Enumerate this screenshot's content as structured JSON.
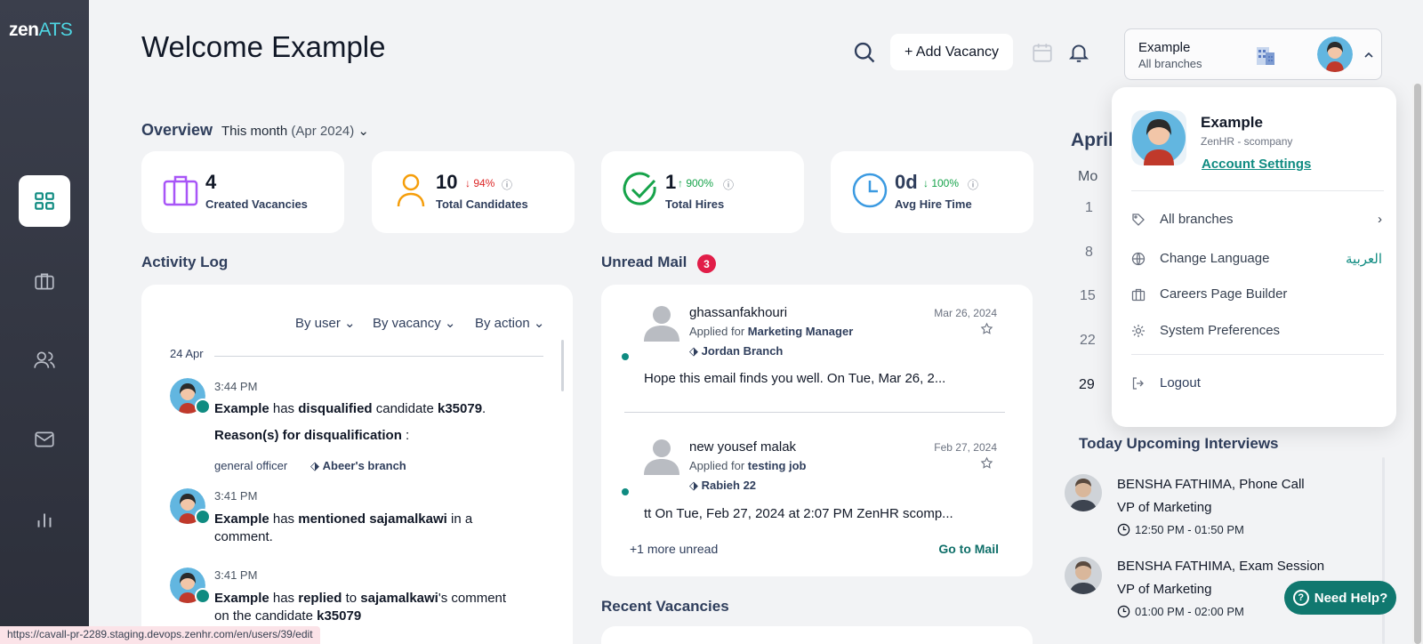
{
  "app": {
    "logo_main": "zen",
    "logo_accent": "ATS"
  },
  "header": {
    "welcome": "Welcome Example",
    "add_vacancy": "+ Add Vacancy",
    "user_name": "Example",
    "user_branch": "All branches"
  },
  "overview": {
    "title": "Overview",
    "range_label": "This month",
    "range_period": "(Apr 2024)",
    "stats": [
      {
        "value": "4",
        "label": "Created Vacancies",
        "delta": "",
        "icon": "briefcase-icon"
      },
      {
        "value": "10",
        "label": "Total Candidates",
        "delta": "↓ 94%",
        "icon": "person-icon"
      },
      {
        "value": "1",
        "label": "Total Hires",
        "delta": "↑ 900%",
        "icon": "check-circle-icon"
      },
      {
        "value": "0d",
        "label": "Avg Hire Time",
        "delta": "↓ 100%",
        "icon": "clock-icon"
      }
    ]
  },
  "activity": {
    "title": "Activity Log",
    "filters": [
      "By user",
      "By vacancy",
      "By action"
    ],
    "date": "24 Apr",
    "items": [
      {
        "time": "3:44 PM",
        "actor": "Example",
        "verb": "disqualified",
        "mid": "candidate",
        "target": "k35079",
        "end": ".",
        "reason_label": "Reason(s) for disqualification",
        "reason_colon": " :",
        "reason": "general officer",
        "branch": "Abeer's branch"
      },
      {
        "time": "3:41 PM",
        "actor": "Example",
        "verb": "mentioned",
        "target": "sajamalkawi",
        "end": "in a comment."
      },
      {
        "time": "3:41 PM",
        "actor": "Example",
        "verb": "replied",
        "mid": "to",
        "target": "sajamalkawi",
        "end": "'s comment",
        "line2": "on the candidate",
        "line2_target": "k35079"
      }
    ]
  },
  "mail": {
    "title": "Unread Mail",
    "unread_count": "3",
    "applied_for": "Applied for",
    "items": [
      {
        "from": "ghassanfakhouri",
        "date": "Mar 26, 2024",
        "job": "Marketing Manager",
        "branch": "Jordan Branch",
        "preview": "Hope this email finds you well. On Tue, Mar 26, 2..."
      },
      {
        "from": "new yousef malak",
        "date": "Feb 27, 2024",
        "job": "testing job",
        "branch": "Rabieh 22",
        "preview": "tt On Tue, Feb 27, 2024 at 2:07 PM ZenHR scomp..."
      }
    ],
    "more_unread": "+1 more unread",
    "go_to_mail": "Go to Mail"
  },
  "recent_vacancies": {
    "title": "Recent Vacancies"
  },
  "calendar": {
    "month": "April",
    "dow": "Mo",
    "days": [
      "1",
      "8",
      "15",
      "22",
      "29"
    ]
  },
  "interviews": {
    "title": "Today Upcoming Interviews",
    "items": [
      {
        "name": "BENSHA FATHIMA, Phone Call",
        "role": "VP of Marketing",
        "time": "12:50 PM - 01:50 PM"
      },
      {
        "name": "BENSHA FATHIMA, Exam Session",
        "role": "VP of Marketing",
        "time": "01:00 PM - 02:00 PM"
      }
    ]
  },
  "dropdown": {
    "name": "Example",
    "org": "ZenHR - scompany",
    "account_settings": "Account Settings",
    "items": [
      {
        "label": "All branches",
        "icon": "tag-icon"
      },
      {
        "label": "Change Language",
        "icon": "globe-icon",
        "right": "العربية"
      },
      {
        "label": "Careers Page Builder",
        "icon": "briefcase-icon"
      },
      {
        "label": "System Preferences",
        "icon": "gear-icon"
      },
      {
        "label": "Logout",
        "icon": "logout-icon"
      }
    ]
  },
  "help": {
    "label": "Need Help?",
    "glyph": "?"
  },
  "status_url": "https://cavall-pr-2289.staging.devops.zenhr.com/en/users/39/edit",
  "colors": {
    "teal": "#0f8b81",
    "sidebar": "#3b3f4c",
    "navy": "#2f3e5c",
    "red_badge": "#e11d48"
  }
}
